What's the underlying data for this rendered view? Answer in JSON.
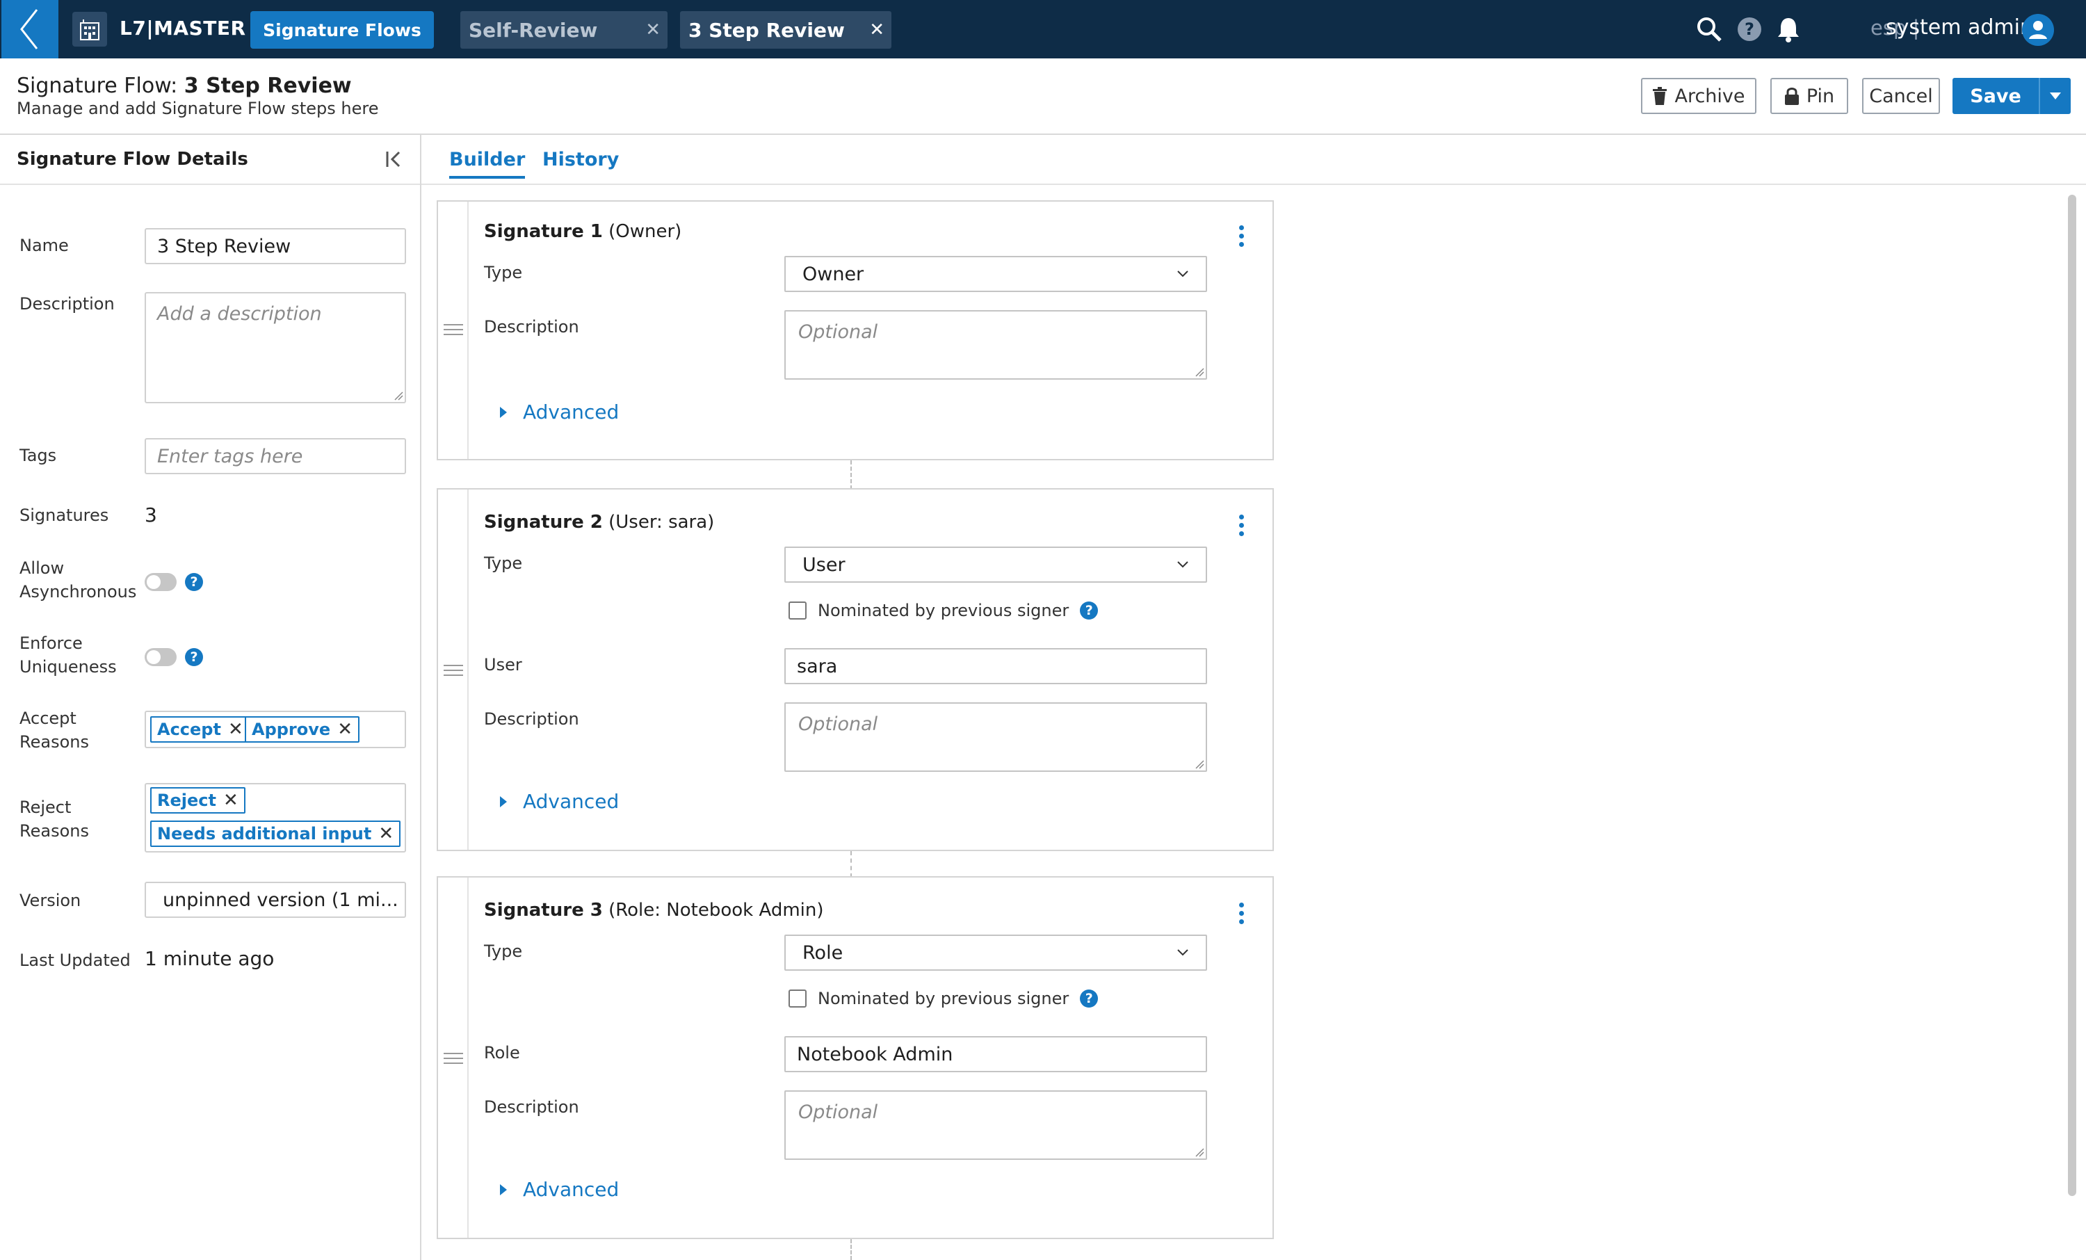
{
  "topbar": {
    "brand": "L7|MASTER",
    "nav_button": "Signature Flows",
    "tabs": [
      {
        "label": "Self-Review",
        "active": false
      },
      {
        "label": "3 Step Review",
        "active": true
      }
    ],
    "close_glyph": "✕",
    "language": "esp |",
    "user_name": "system admin",
    "icons": [
      "back-chevron-icon",
      "building-icon",
      "search-icon",
      "help-icon",
      "bell-icon",
      "user-avatar-icon"
    ]
  },
  "header": {
    "title_prefix": "Signature Flow: ",
    "title_name": "3 Step Review",
    "subtitle": "Manage and add Signature Flow steps here",
    "archive_label": "Archive",
    "pin_label": "Pin",
    "cancel_label": "Cancel",
    "save_label": "Save"
  },
  "sidebar": {
    "title": "Signature Flow Details",
    "name_label": "Name",
    "name_value": "3 Step Review",
    "description_label": "Description",
    "description_placeholder": "Add a description",
    "tags_label": "Tags",
    "tags_placeholder": "Enter tags here",
    "signatures_label": "Signatures",
    "signatures_value": "3",
    "allow_async_label_1": "Allow",
    "allow_async_label_2": "Asynchronous",
    "allow_async_on": false,
    "enforce_unique_label_1": "Enforce",
    "enforce_unique_label_2": "Uniqueness",
    "enforce_unique_on": false,
    "accept_label_1": "Accept",
    "accept_label_2": "Reasons",
    "accept_reasons": [
      "Accept",
      "Approve"
    ],
    "reject_label_1": "Reject",
    "reject_label_2": "Reasons",
    "reject_reasons": [
      "Reject",
      "Needs additional input"
    ],
    "remove_glyph": "✕",
    "version_label": "Version",
    "version_value": "unpinned version (1 mi...",
    "last_updated_label": "Last Updated",
    "last_updated_value": "1 minute ago"
  },
  "main": {
    "tabs": [
      {
        "label": "Builder",
        "active": true
      },
      {
        "label": "History",
        "active": false
      }
    ],
    "type_label": "Type",
    "description_label": "Description",
    "description_placeholder": "Optional",
    "advanced_label": "Advanced",
    "nominated_label": "Nominated by previous signer",
    "signatures": [
      {
        "title": "Signature 1",
        "subtitle": " (Owner)",
        "type": "Owner"
      },
      {
        "title": "Signature 2",
        "subtitle": " (User: sara)",
        "type": "User",
        "field_label": "User",
        "field_value": "sara"
      },
      {
        "title": "Signature 3",
        "subtitle": " (Role: Notebook Admin)",
        "type": "Role",
        "field_label": "Role",
        "field_value": "Notebook Admin"
      }
    ]
  },
  "colors": {
    "topbar": "#0e2c47",
    "accent": "#1578c2",
    "tab_bg": "#2e4a66"
  }
}
